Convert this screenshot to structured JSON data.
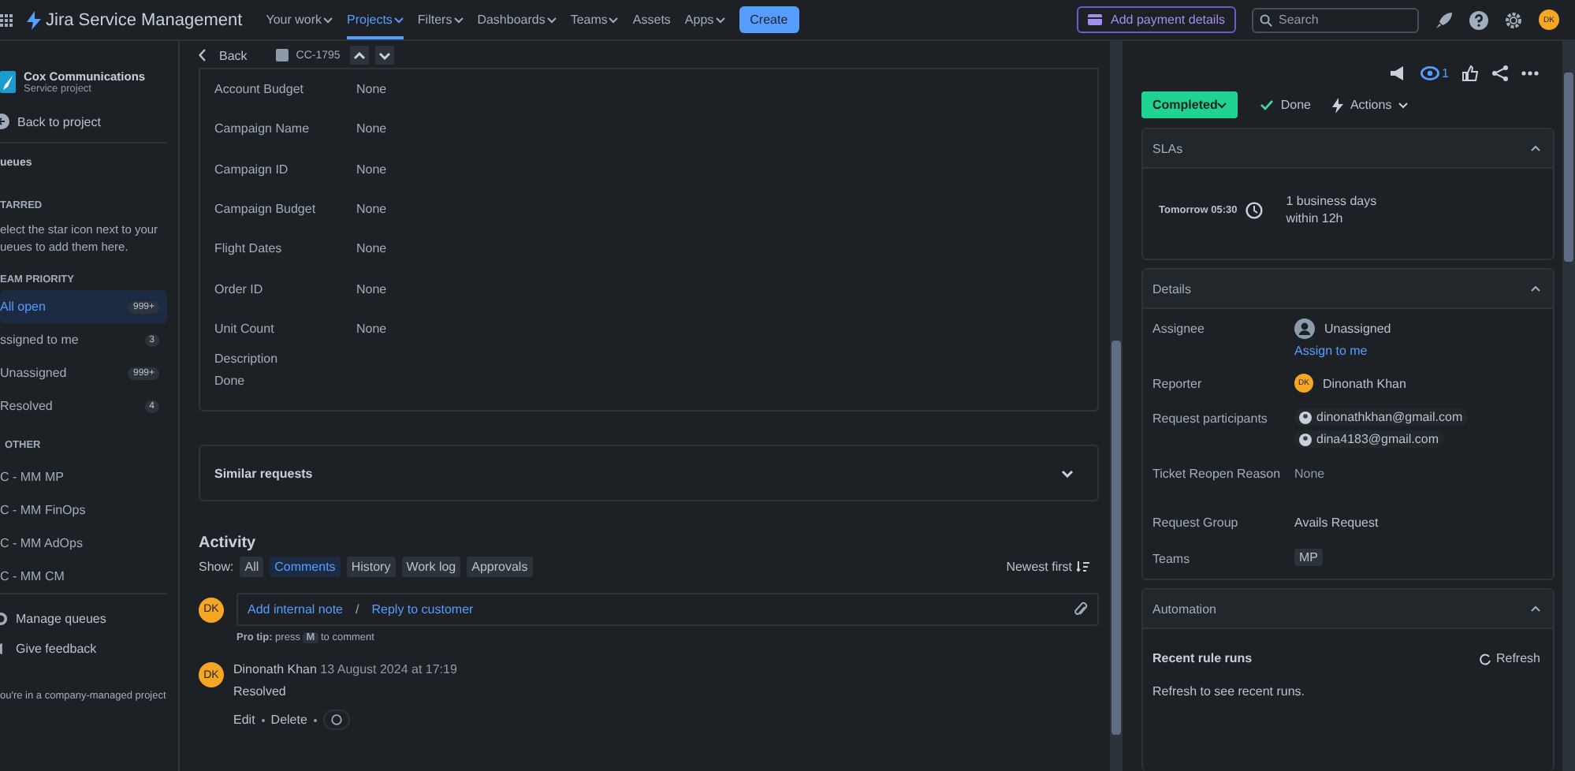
{
  "nav": {
    "logo": "Jira Service Management",
    "items": [
      {
        "label": "Your work",
        "caret": true,
        "selected": false
      },
      {
        "label": "Projects",
        "caret": true,
        "selected": true
      },
      {
        "label": "Filters",
        "caret": true,
        "selected": false
      },
      {
        "label": "Dashboards",
        "caret": true,
        "selected": false
      },
      {
        "label": "Teams",
        "caret": true,
        "selected": false
      },
      {
        "label": "Assets",
        "caret": false,
        "selected": false
      },
      {
        "label": "Apps",
        "caret": true,
        "selected": false
      }
    ],
    "create": "Create",
    "payment": "Add payment details",
    "search_placeholder": "Search",
    "avatar": "DK"
  },
  "sidebar": {
    "project_name": "Cox Communications",
    "project_type": "Service project",
    "back": "Back to project",
    "queues": "ueues",
    "starred": "TARRED",
    "starred_hint": "elect the star icon next to your ueues to add them here.",
    "team": "EAM PRIORITY",
    "team_items": [
      {
        "label": "All open",
        "count": "999+",
        "selected": true
      },
      {
        "label": "ssigned to me",
        "count": "3",
        "selected": false
      },
      {
        "label": "Unassigned",
        "count": "999+",
        "selected": false
      },
      {
        "label": "Resolved",
        "count": "4",
        "selected": false
      }
    ],
    "other": "OTHER",
    "other_items": [
      "C - MM MP",
      "C - MM FinOps",
      "C - MM AdOps",
      "C - MM CM"
    ],
    "manage": "Manage queues",
    "feedback": "Give feedback",
    "footer": "ou're in a company-managed project"
  },
  "issue": {
    "back": "Back",
    "key": "CC-1795",
    "fields": [
      {
        "label": "Account Budget",
        "value": "None"
      },
      {
        "label": "Campaign Name",
        "value": "None"
      },
      {
        "label": "Campaign ID",
        "value": "None"
      },
      {
        "label": "Campaign Budget",
        "value": "None"
      },
      {
        "label": "Flight Dates",
        "value": "None"
      },
      {
        "label": "Order ID",
        "value": "None"
      },
      {
        "label": "Unit Count",
        "value": "None"
      }
    ],
    "description_label": "Description",
    "description": "Done",
    "similar": "Similar requests",
    "activity": {
      "title": "Activity",
      "show": "Show:",
      "filters": [
        {
          "label": "All",
          "selected": false
        },
        {
          "label": "Comments",
          "selected": true
        },
        {
          "label": "History",
          "selected": false
        },
        {
          "label": "Work log",
          "selected": false
        },
        {
          "label": "Approvals",
          "selected": false
        }
      ],
      "sort": "Newest first",
      "avatar": "DK",
      "note": "Add internal note",
      "separator": "/",
      "reply": "Reply to customer",
      "pro_tip": "Pro tip:",
      "press": "press",
      "key": "M",
      "to_comment": "to comment",
      "comment": {
        "avatar": "DK",
        "author": "Dinonath Khan",
        "date": "13 August 2024 at 17:19",
        "body": "Resolved",
        "actions": [
          "Edit",
          "Delete"
        ]
      }
    }
  },
  "panel": {
    "watchers": "1",
    "status": "Completed",
    "done": "Done",
    "actions": "Actions",
    "sla": {
      "title": "SLAs",
      "time": "Tomorrow 05:30",
      "line1": "1 business days",
      "line2": "within 12h"
    },
    "details": {
      "title": "Details",
      "rows": [
        {
          "label": "Assignee",
          "kind": "unassigned",
          "value": "Unassigned",
          "link": "Assign to me"
        },
        {
          "label": "Reporter",
          "kind": "person",
          "initials": "DK",
          "value": "Dinonath Khan"
        },
        {
          "label": "Request participants",
          "kind": "chips",
          "values": [
            "dinonathkhan@gmail.com",
            "dina4183@gmail.com"
          ]
        },
        {
          "label": "Ticket Reopen Reason",
          "kind": "muted",
          "value": "None"
        },
        {
          "label": "Request Group",
          "kind": "text",
          "value": "Avails Request"
        },
        {
          "label": "Teams",
          "kind": "tag",
          "value": "MP"
        }
      ]
    },
    "automation": {
      "title": "Automation",
      "heading": "Recent rule runs",
      "refresh": "Refresh",
      "hint": "Refresh to see recent runs."
    }
  }
}
